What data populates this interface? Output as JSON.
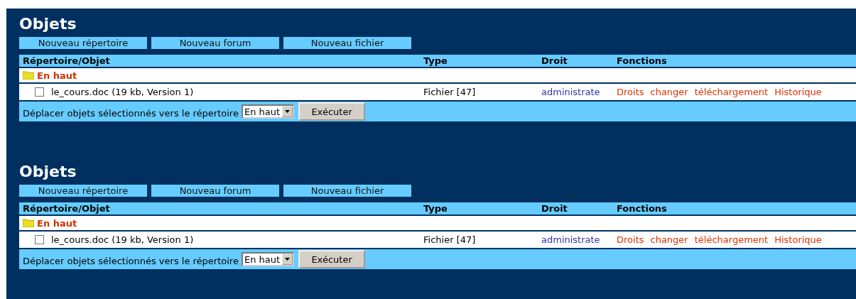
{
  "sections": [
    {
      "title": "Objets",
      "buttons": [
        "Nouveau répertoire",
        "Nouveau forum",
        "Nouveau fichier"
      ],
      "columns": [
        "Répertoire/Objet",
        "Type",
        "Droit",
        "Fonctions"
      ],
      "parent_folder": "En haut",
      "rows": [
        {
          "checked": false,
          "name": "le_cours.doc (19 kb, Version 1)",
          "type": "Fichier [47]",
          "right": "administrate",
          "functions": [
            "Droits",
            "changer",
            "téléchargement",
            "Historique"
          ]
        }
      ],
      "move_label": "Déplacer objets sélectionnés vers le répertoire",
      "move_target": "En haut",
      "execute": "Exécuter"
    },
    {
      "title": "Objets",
      "buttons": [
        "Nouveau répertoire",
        "Nouveau forum",
        "Nouveau fichier"
      ],
      "columns": [
        "Répertoire/Objet",
        "Type",
        "Droit",
        "Fonctions"
      ],
      "parent_folder": "En haut",
      "rows": [
        {
          "checked": false,
          "name": "le_cours.doc (19 kb, Version 1)",
          "type": "Fichier [47]",
          "right": "administrate",
          "functions": [
            "Droits",
            "changer",
            "téléchargement",
            "Historique"
          ]
        }
      ],
      "move_label": "Déplacer objets sélectionnés vers le répertoire",
      "move_target": "En haut",
      "execute": "Exécuter"
    }
  ]
}
